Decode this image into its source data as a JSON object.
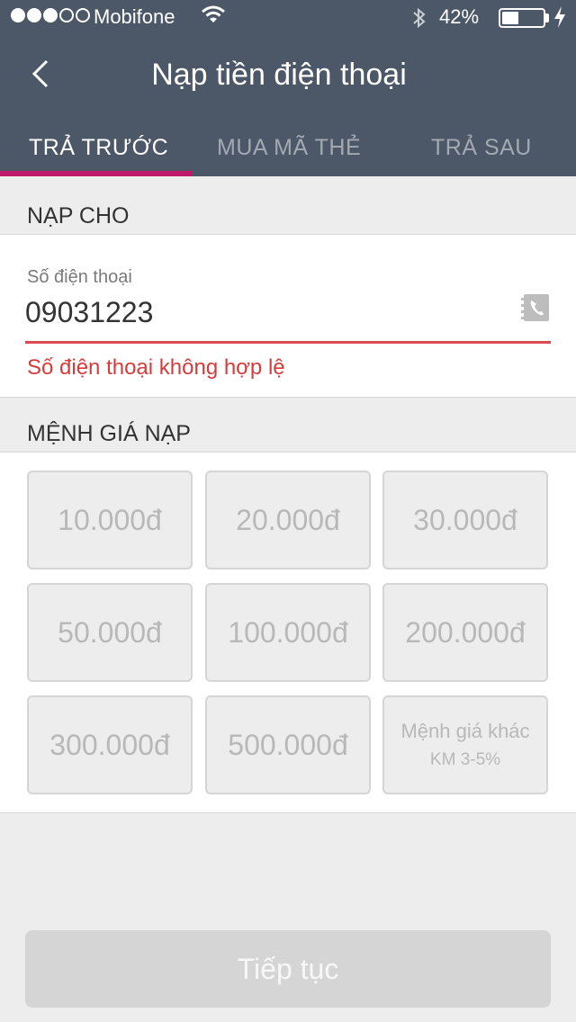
{
  "status_bar": {
    "carrier": "Mobifone",
    "battery_pct": "42%",
    "battery_level": 0.42,
    "signal_bars_filled": 3,
    "signal_bars_total": 5
  },
  "header": {
    "title": "Nạp tiền điện thoại",
    "back_icon": "chevron-left-icon"
  },
  "tabs": [
    {
      "label": "TRẢ TRƯỚC",
      "active": true
    },
    {
      "label": "MUA MÃ THẺ",
      "active": false
    },
    {
      "label": "TRẢ SAU",
      "active": false
    }
  ],
  "recharge_for": {
    "section_label": "NẠP CHO",
    "field_label": "Số điện thoại",
    "phone_value": "09031223",
    "error": "Số điện thoại không hợp lệ",
    "contacts_icon": "contacts-icon"
  },
  "amounts": {
    "section_label": "MỆNH GIÁ NẠP",
    "options": [
      "10.000đ",
      "20.000đ",
      "30.000đ",
      "50.000đ",
      "100.000đ",
      "200.000đ",
      "300.000đ",
      "500.000đ"
    ],
    "other": {
      "label": "Mệnh giá khác",
      "promo": "KM 3-5%"
    }
  },
  "continue_label": "Tiếp tục",
  "colors": {
    "header_bg": "#4c5867",
    "tab_indicator": "#c1196a",
    "error": "#d63c3c",
    "disabled_button": "#d5d5d5"
  }
}
